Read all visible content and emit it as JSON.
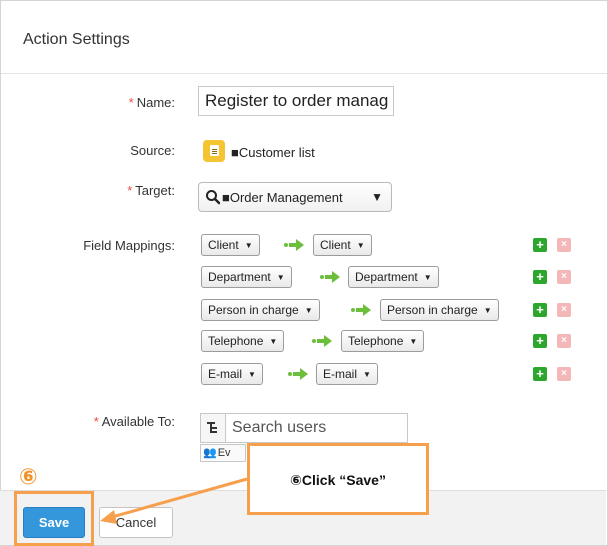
{
  "dialog": {
    "title": "Action Settings"
  },
  "form": {
    "name": {
      "label": "Name:",
      "required_mark": "*",
      "value": "Register to order manag"
    },
    "source": {
      "label": "Source:",
      "app_icon": "app-icon",
      "value": "■Customer list"
    },
    "target": {
      "label": "Target:",
      "required_mark": "*",
      "search_icon": "search-icon",
      "value": "■Order Management",
      "arrow": "▼"
    },
    "field_mappings": {
      "label": "Field Mappings:",
      "rows": [
        {
          "from": "Client",
          "to": "Client"
        },
        {
          "from": "Department",
          "to": "Department"
        },
        {
          "from": "Person in charge",
          "to": "Person in charge"
        },
        {
          "from": "Telephone",
          "to": "Telephone"
        },
        {
          "from": "E-mail",
          "to": "E-mail"
        }
      ],
      "add_label": "+",
      "remove_label": "×"
    },
    "available_to": {
      "label": "Available To:",
      "required_mark": "*",
      "search_placeholder": "Search users",
      "chip_text": "Ev"
    }
  },
  "footer": {
    "save_label": "Save",
    "cancel_label": "Cancel"
  },
  "annotation": {
    "step_number": "⑥",
    "callout_text": "⑥Click “Save”",
    "color": "#f6a04d"
  },
  "colors": {
    "save_button": "#3597db",
    "add_button": "#2da62d",
    "remove_button": "#f3b7b7",
    "required": "#e74c3c"
  }
}
